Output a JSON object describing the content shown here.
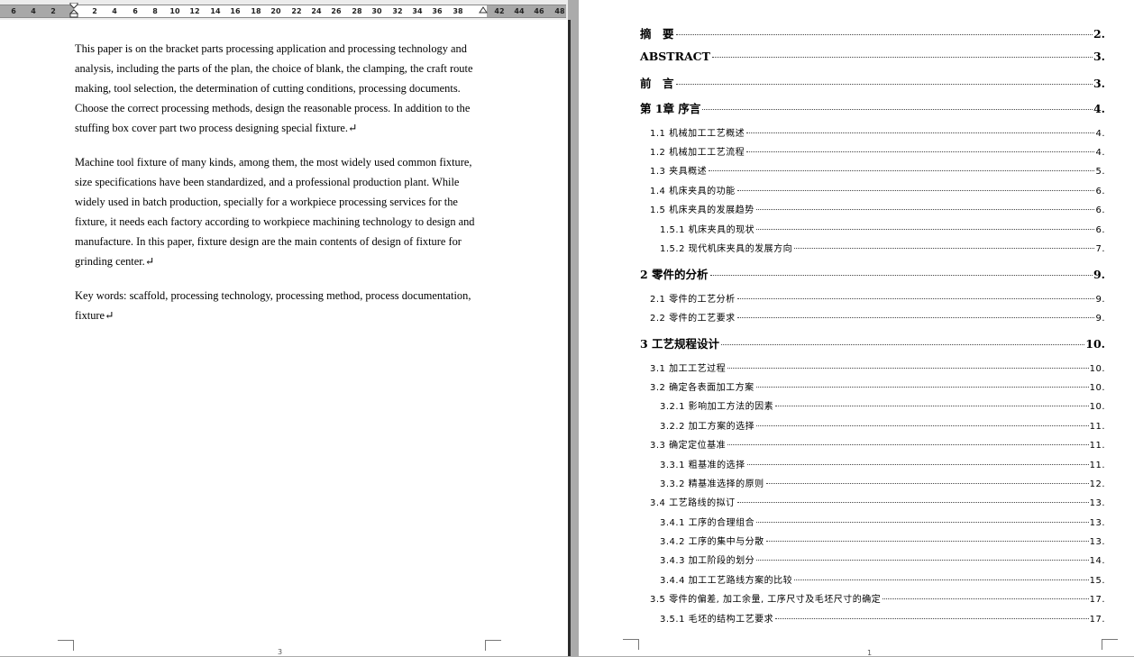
{
  "ruler": {
    "labels": [
      "6",
      "4",
      "2",
      "2",
      "4",
      "6",
      "8",
      "10",
      "12",
      "14",
      "16",
      "18",
      "20",
      "22",
      "24",
      "26",
      "28",
      "30",
      "32",
      "34",
      "36",
      "38",
      "42",
      "44",
      "46",
      "48"
    ]
  },
  "left_page": {
    "paragraphs": [
      "This paper is on the bracket parts processing application and processing technology and analysis, including the parts of the plan, the choice of blank, the clamping, the craft route making, tool selection, the determination of cutting conditions, processing documents. Choose the correct processing methods, design the reasonable process. In addition to the stuffing box cover part two process designing special fixture.↵",
      "Machine tool fixture of many kinds, among them, the most widely used common fixture, size specifications have been standardized, and a professional production plant. While widely used in batch production, specially for a workpiece processing services for the fixture, it needs each factory according to workpiece machining technology to design and manufacture. In this paper, fixture design are the main contents of design of fixture for grinding center.↵",
      "Key words: scaffold, processing technology, processing method, process documentation, fixture↵"
    ],
    "page_number": "3"
  },
  "toc": {
    "entries": [
      {
        "title": "摘　要",
        "page": "2.",
        "level": 1
      },
      {
        "title": "ABSTRACT",
        "page": "3.",
        "level": 1
      },
      {
        "title": "前　言",
        "page": "3.",
        "level": 1
      },
      {
        "title": "第 1章  序言",
        "page": "4.",
        "level": 1
      },
      {
        "title": "1.1 机械加工工艺概述",
        "page": "4.",
        "level": 2
      },
      {
        "title": "1.2 机械加工工艺流程",
        "page": "4.",
        "level": 2
      },
      {
        "title": "1.3 夹具概述",
        "page": "5.",
        "level": 2
      },
      {
        "title": "1.4 机床夹具的功能",
        "page": "6.",
        "level": 2
      },
      {
        "title": "1.5 机床夹具的发展趋势",
        "page": "6.",
        "level": 2
      },
      {
        "title": "1.5.1 机床夹具的现状",
        "page": "6.",
        "level": 3
      },
      {
        "title": "1.5.2 现代机床夹具的发展方向",
        "page": "7.",
        "level": 3
      },
      {
        "title": "2 零件的分析",
        "page": "9.",
        "level": 1
      },
      {
        "title": "2.1 零件的工艺分析",
        "page": "9.",
        "level": 2
      },
      {
        "title": "2.2 零件的工艺要求",
        "page": "9.",
        "level": 2
      },
      {
        "title": "3 工艺规程设计",
        "page": "10.",
        "level": 1
      },
      {
        "title": "3.1 加工工艺过程",
        "page": "10.",
        "level": 2
      },
      {
        "title": "3.2 确定各表面加工方案",
        "page": "10.",
        "level": 2
      },
      {
        "title": "3.2.1 影响加工方法的因素",
        "page": "10.",
        "level": 3
      },
      {
        "title": "3.2.2 加工方案的选择",
        "page": "11.",
        "level": 3
      },
      {
        "title": "3.3 确定定位基准",
        "page": "11.",
        "level": 2
      },
      {
        "title": "3.3.1 粗基准的选择",
        "page": "11.",
        "level": 3
      },
      {
        "title": "3.3.2 精基准选择的原则",
        "page": "12.",
        "level": 3
      },
      {
        "title": "3.4 工艺路线的拟订",
        "page": "13.",
        "level": 2
      },
      {
        "title": "3.4.1 工序的合理组合",
        "page": "13.",
        "level": 3
      },
      {
        "title": "3.4.2 工序的集中与分散",
        "page": "13.",
        "level": 3
      },
      {
        "title": "3.4.3 加工阶段的划分",
        "page": "14.",
        "level": 3
      },
      {
        "title": "3.4.4 加工工艺路线方案的比较",
        "page": "15.",
        "level": 3
      },
      {
        "title": "3.5 零件的偏差, 加工余量, 工序尺寸及毛坯尺寸的确定",
        "page": "17.",
        "level": 2
      },
      {
        "title": "3.5.1 毛坯的结构工艺要求",
        "page": "17.",
        "level": 3
      }
    ],
    "page_number": "1"
  }
}
